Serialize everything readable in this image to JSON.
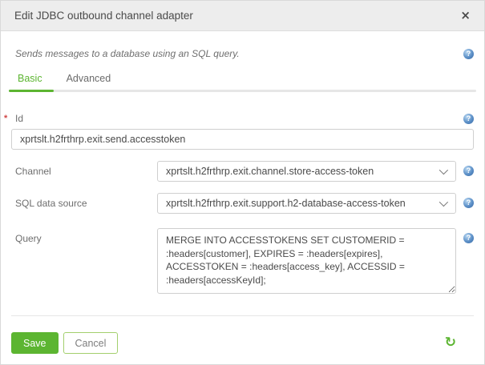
{
  "dialog": {
    "title": "Edit JDBC outbound channel adapter",
    "description": "Sends messages to a database using an SQL query."
  },
  "tabs": {
    "basic": "Basic",
    "advanced": "Advanced"
  },
  "fields": {
    "id": {
      "label": "Id",
      "required_marker": "*",
      "value": "xprtslt.h2frthrp.exit.send.accesstoken"
    },
    "channel": {
      "label": "Channel",
      "value": "xprtslt.h2frthrp.exit.channel.store-access-token"
    },
    "sql_data_source": {
      "label": "SQL data source",
      "value": "xprtslt.h2frthrp.exit.support.h2-database-access-token"
    },
    "query": {
      "label": "Query",
      "value": "MERGE INTO ACCESSTOKENS SET CUSTOMERID = :headers[customer], EXPIRES = :headers[expires], ACCESSTOKEN = :headers[access_key], ACCESSID = :headers[accessKeyId];"
    }
  },
  "buttons": {
    "save": "Save",
    "cancel": "Cancel"
  },
  "icons": {
    "close": "×",
    "help": "?",
    "refresh": "↻"
  },
  "colors": {
    "accent_green": "#5cb531",
    "help_blue": "#4a80c0",
    "required_red": "#cf4444",
    "header_bg": "#ededed"
  }
}
